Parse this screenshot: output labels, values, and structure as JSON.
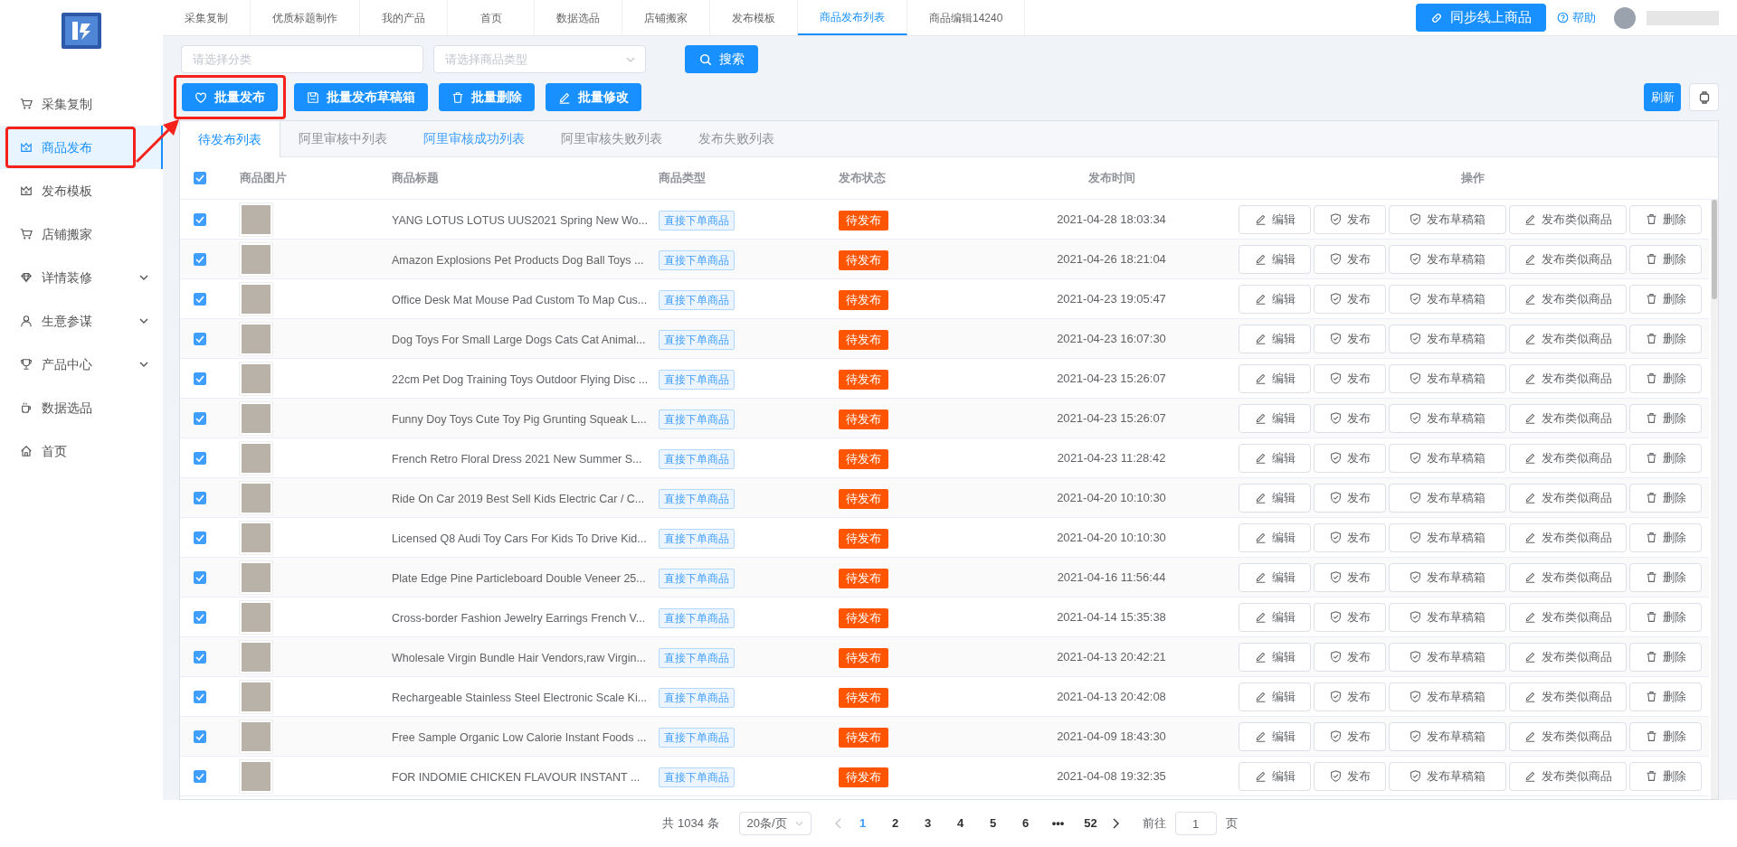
{
  "top_tabs": [
    {
      "label": "采集复制",
      "selected": false
    },
    {
      "label": "优质标题制作",
      "selected": false
    },
    {
      "label": "我的产品",
      "selected": false
    },
    {
      "label": "首页",
      "selected": false
    },
    {
      "label": "数据选品",
      "selected": false
    },
    {
      "label": "店铺搬家",
      "selected": false
    },
    {
      "label": "发布模板",
      "selected": false
    },
    {
      "label": "商品发布列表",
      "selected": true
    },
    {
      "label": "商品编辑14240",
      "selected": false
    }
  ],
  "sync_button": "同步线上商品",
  "help_link": "帮助",
  "sidebar": [
    {
      "label": "采集复制",
      "kind": "cart",
      "selected": false,
      "expandable": false,
      "highlighted": false
    },
    {
      "label": "商品发布",
      "kind": "crown",
      "selected": true,
      "expandable": false,
      "highlighted": true
    },
    {
      "label": "发布模板",
      "kind": "crown",
      "selected": false,
      "expandable": false,
      "highlighted": false
    },
    {
      "label": "店铺搬家",
      "kind": "cart",
      "selected": false,
      "expandable": false,
      "highlighted": false
    },
    {
      "label": "详情装修",
      "kind": "diamond",
      "selected": false,
      "expandable": true,
      "highlighted": false
    },
    {
      "label": "生意参谋",
      "kind": "user",
      "selected": false,
      "expandable": true,
      "highlighted": false
    },
    {
      "label": "产品中心",
      "kind": "trophy",
      "selected": false,
      "expandable": true,
      "highlighted": false
    },
    {
      "label": "数据选品",
      "kind": "cup",
      "selected": false,
      "expandable": false,
      "highlighted": false
    },
    {
      "label": "首页",
      "kind": "home",
      "selected": false,
      "expandable": false,
      "highlighted": false
    }
  ],
  "filters": {
    "category_placeholder": "请选择分类",
    "type_placeholder": "请选择商品类型",
    "search_button": "搜索"
  },
  "batch_buttons": [
    {
      "label": "批量发布",
      "kind": "heart",
      "highlighted": true
    },
    {
      "label": "批量发布草稿箱",
      "kind": "save",
      "highlighted": false
    },
    {
      "label": "批量删除",
      "kind": "trash",
      "highlighted": false
    },
    {
      "label": "批量修改",
      "kind": "edit",
      "highlighted": false
    }
  ],
  "annotation_arrow": true,
  "refresh_button": "刷新",
  "list_tabs": [
    {
      "label": "待发布列表",
      "selected": true,
      "hover": false
    },
    {
      "label": "阿里审核中列表",
      "selected": false,
      "hover": false
    },
    {
      "label": "阿里审核成功列表",
      "selected": false,
      "hover": true
    },
    {
      "label": "阿里审核失败列表",
      "selected": false,
      "hover": false
    },
    {
      "label": "发布失败列表",
      "selected": false,
      "hover": false
    }
  ],
  "table": {
    "columns": [
      "商品图片",
      "商品标题",
      "商品类型",
      "发布状态",
      "发布时间",
      "操作"
    ],
    "all_checked": true,
    "rows": [
      {
        "checked": true,
        "title": "YANG LOTUS LOTUS UUS2021 Spring New Wo...",
        "type": "直接下单商品",
        "status": "待发布",
        "time": "2021-04-28 18:03:34",
        "actions": [
          {
            "label": "编辑",
            "kind": "edit"
          },
          {
            "label": "发布",
            "kind": "shield"
          },
          {
            "label": "发布草稿箱",
            "kind": "shield"
          },
          {
            "label": "发布类似商品",
            "kind": "edit"
          },
          {
            "label": "删除",
            "kind": "trash"
          }
        ]
      },
      {
        "checked": true,
        "title": "Amazon Explosions Pet Products Dog Ball Toys ...",
        "type": "直接下单商品",
        "status": "待发布",
        "time": "2021-04-26 18:21:04",
        "actions": [
          {
            "label": "编辑",
            "kind": "edit"
          },
          {
            "label": "发布",
            "kind": "shield"
          },
          {
            "label": "发布草稿箱",
            "kind": "shield"
          },
          {
            "label": "发布类似商品",
            "kind": "edit"
          },
          {
            "label": "删除",
            "kind": "trash"
          }
        ]
      },
      {
        "checked": true,
        "title": "Office Desk Mat Mouse Pad Custom To Map Cus...",
        "type": "直接下单商品",
        "status": "待发布",
        "time": "2021-04-23 19:05:47",
        "actions": [
          {
            "label": "编辑",
            "kind": "edit"
          },
          {
            "label": "发布",
            "kind": "shield"
          },
          {
            "label": "发布草稿箱",
            "kind": "shield"
          },
          {
            "label": "发布类似商品",
            "kind": "edit"
          },
          {
            "label": "删除",
            "kind": "trash"
          }
        ]
      },
      {
        "checked": true,
        "title": "Dog Toys For Small Large Dogs Cats Cat Animal...",
        "type": "直接下单商品",
        "status": "待发布",
        "time": "2021-04-23 16:07:30",
        "actions": [
          {
            "label": "编辑",
            "kind": "edit"
          },
          {
            "label": "发布",
            "kind": "shield"
          },
          {
            "label": "发布草稿箱",
            "kind": "shield"
          },
          {
            "label": "发布类似商品",
            "kind": "edit"
          },
          {
            "label": "删除",
            "kind": "trash"
          }
        ]
      },
      {
        "checked": true,
        "title": "22cm Pet Dog Training Toys Outdoor Flying Disc ...",
        "type": "直接下单商品",
        "status": "待发布",
        "time": "2021-04-23 15:26:07",
        "actions": [
          {
            "label": "编辑",
            "kind": "edit"
          },
          {
            "label": "发布",
            "kind": "shield"
          },
          {
            "label": "发布草稿箱",
            "kind": "shield"
          },
          {
            "label": "发布类似商品",
            "kind": "edit"
          },
          {
            "label": "删除",
            "kind": "trash"
          }
        ]
      },
      {
        "checked": true,
        "title": "Funny Doy Toys Cute Toy Pig Grunting Squeak L...",
        "type": "直接下单商品",
        "status": "待发布",
        "time": "2021-04-23 15:26:07",
        "actions": [
          {
            "label": "编辑",
            "kind": "edit"
          },
          {
            "label": "发布",
            "kind": "shield"
          },
          {
            "label": "发布草稿箱",
            "kind": "shield"
          },
          {
            "label": "发布类似商品",
            "kind": "edit"
          },
          {
            "label": "删除",
            "kind": "trash"
          }
        ]
      },
      {
        "checked": true,
        "title": "French Retro Floral Dress 2021 New Summer S...",
        "type": "直接下单商品",
        "status": "待发布",
        "time": "2021-04-23 11:28:42",
        "actions": [
          {
            "label": "编辑",
            "kind": "edit"
          },
          {
            "label": "发布",
            "kind": "shield"
          },
          {
            "label": "发布草稿箱",
            "kind": "shield"
          },
          {
            "label": "发布类似商品",
            "kind": "edit"
          },
          {
            "label": "删除",
            "kind": "trash"
          }
        ]
      },
      {
        "checked": true,
        "title": "Ride On Car 2019 Best Sell Kids Electric Car / C...",
        "type": "直接下单商品",
        "status": "待发布",
        "time": "2021-04-20 10:10:30",
        "actions": [
          {
            "label": "编辑",
            "kind": "edit"
          },
          {
            "label": "发布",
            "kind": "shield"
          },
          {
            "label": "发布草稿箱",
            "kind": "shield"
          },
          {
            "label": "发布类似商品",
            "kind": "edit"
          },
          {
            "label": "删除",
            "kind": "trash"
          }
        ]
      },
      {
        "checked": true,
        "title": "Licensed Q8 Audi Toy Cars For Kids To Drive Kid...",
        "type": "直接下单商品",
        "status": "待发布",
        "time": "2021-04-20 10:10:30",
        "actions": [
          {
            "label": "编辑",
            "kind": "edit"
          },
          {
            "label": "发布",
            "kind": "shield"
          },
          {
            "label": "发布草稿箱",
            "kind": "shield"
          },
          {
            "label": "发布类似商品",
            "kind": "edit"
          },
          {
            "label": "删除",
            "kind": "trash"
          }
        ]
      },
      {
        "checked": true,
        "title": "Plate Edge Pine Particleboard Double Veneer 25...",
        "type": "直接下单商品",
        "status": "待发布",
        "time": "2021-04-16 11:56:44",
        "actions": [
          {
            "label": "编辑",
            "kind": "edit"
          },
          {
            "label": "发布",
            "kind": "shield"
          },
          {
            "label": "发布草稿箱",
            "kind": "shield"
          },
          {
            "label": "发布类似商品",
            "kind": "edit"
          },
          {
            "label": "删除",
            "kind": "trash"
          }
        ]
      },
      {
        "checked": true,
        "title": "Cross-border Fashion Jewelry Earrings French V...",
        "type": "直接下单商品",
        "status": "待发布",
        "time": "2021-04-14 15:35:38",
        "actions": [
          {
            "label": "编辑",
            "kind": "edit"
          },
          {
            "label": "发布",
            "kind": "shield"
          },
          {
            "label": "发布草稿箱",
            "kind": "shield"
          },
          {
            "label": "发布类似商品",
            "kind": "edit"
          },
          {
            "label": "删除",
            "kind": "trash"
          }
        ]
      },
      {
        "checked": true,
        "title": "Wholesale Virgin Bundle Hair Vendors,raw Virgin...",
        "type": "直接下单商品",
        "status": "待发布",
        "time": "2021-04-13 20:42:21",
        "actions": [
          {
            "label": "编辑",
            "kind": "edit"
          },
          {
            "label": "发布",
            "kind": "shield"
          },
          {
            "label": "发布草稿箱",
            "kind": "shield"
          },
          {
            "label": "发布类似商品",
            "kind": "edit"
          },
          {
            "label": "删除",
            "kind": "trash"
          }
        ]
      },
      {
        "checked": true,
        "title": "Rechargeable Stainless Steel Electronic Scale Ki...",
        "type": "直接下单商品",
        "status": "待发布",
        "time": "2021-04-13 20:42:08",
        "actions": [
          {
            "label": "编辑",
            "kind": "edit"
          },
          {
            "label": "发布",
            "kind": "shield"
          },
          {
            "label": "发布草稿箱",
            "kind": "shield"
          },
          {
            "label": "发布类似商品",
            "kind": "edit"
          },
          {
            "label": "删除",
            "kind": "trash"
          }
        ]
      },
      {
        "checked": true,
        "title": "Free Sample Organic Low Calorie Instant Foods ...",
        "type": "直接下单商品",
        "status": "待发布",
        "time": "2021-04-09 18:43:30",
        "actions": [
          {
            "label": "编辑",
            "kind": "edit"
          },
          {
            "label": "发布",
            "kind": "shield"
          },
          {
            "label": "发布草稿箱",
            "kind": "shield"
          },
          {
            "label": "发布类似商品",
            "kind": "edit"
          },
          {
            "label": "删除",
            "kind": "trash"
          }
        ]
      },
      {
        "checked": true,
        "title": "FOR INDOMIE CHICKEN FLAVOUR INSTANT ...",
        "type": "直接下单商品",
        "status": "待发布",
        "time": "2021-04-08 19:32:35",
        "actions": [
          {
            "label": "编辑",
            "kind": "edit"
          },
          {
            "label": "发布",
            "kind": "shield"
          },
          {
            "label": "发布草稿箱",
            "kind": "shield"
          },
          {
            "label": "发布类似商品",
            "kind": "edit"
          },
          {
            "label": "删除",
            "kind": "trash"
          }
        ]
      }
    ]
  },
  "pagination": {
    "total": "共 1034 条",
    "page_size": "20条/页",
    "pages": [
      {
        "label": "1",
        "selected": true
      },
      {
        "label": "2",
        "selected": false
      },
      {
        "label": "3",
        "selected": false
      },
      {
        "label": "4",
        "selected": false
      },
      {
        "label": "5",
        "selected": false
      },
      {
        "label": "6",
        "selected": false
      },
      {
        "label": "•••",
        "selected": false
      },
      {
        "label": "52",
        "selected": false
      }
    ],
    "goto_label": "前往",
    "goto_value": "1",
    "page_suffix": "页"
  }
}
